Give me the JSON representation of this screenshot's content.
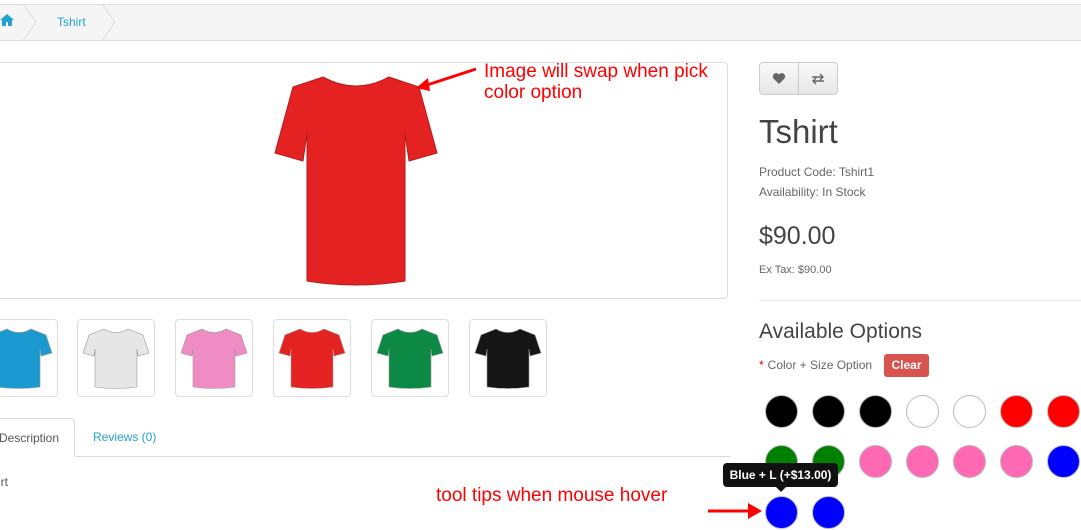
{
  "breadcrumb": {
    "home_icon": "home-icon",
    "items": [
      "Tshirt"
    ]
  },
  "product": {
    "name": "Tshirt",
    "product_code_line": "Product Code: Tshirt1",
    "availability_line": "Availability: In Stock",
    "price": "$90.00",
    "ex_tax_line": "Ex Tax: $90.00"
  },
  "actions": {
    "wishlist_icon": "heart-icon",
    "compare_icon": "exchange-icon"
  },
  "thumbnails": [
    {
      "color": "#1a9ad0"
    },
    {
      "color": "#e6e6e6"
    },
    {
      "color": "#f08cc4"
    },
    {
      "color": "#e52222"
    },
    {
      "color": "#0c8a45"
    },
    {
      "color": "#151515"
    }
  ],
  "main_image": {
    "color": "#e52222"
  },
  "tabs": {
    "description": "Description",
    "reviews": "Reviews (0)",
    "content": "irt"
  },
  "options": {
    "heading": "Available Options",
    "required_mark": "*",
    "label": "Color + Size Option",
    "clear_label": "Clear",
    "swatches": [
      [
        "#000000",
        "#000000",
        "#000000",
        "#ffffff",
        "#ffffff",
        "#ff0000",
        "#ff0000"
      ],
      [
        "#008000",
        "#008000",
        "#ff69b4",
        "#ff69b4",
        "#ff69b4",
        "#ff69b4",
        "#0000ff"
      ],
      [
        "#0000ff",
        "#0000ff"
      ]
    ],
    "tooltip": "Blue + L (+$13.00)"
  },
  "annotations": {
    "image_note_line1": "Image will swap when pick",
    "image_note_line2": "color option",
    "tooltip_note": "tool tips when mouse hover"
  },
  "colors": {
    "link": "#23a1d1",
    "danger": "#d9534f",
    "annotation": "#ff0000"
  }
}
